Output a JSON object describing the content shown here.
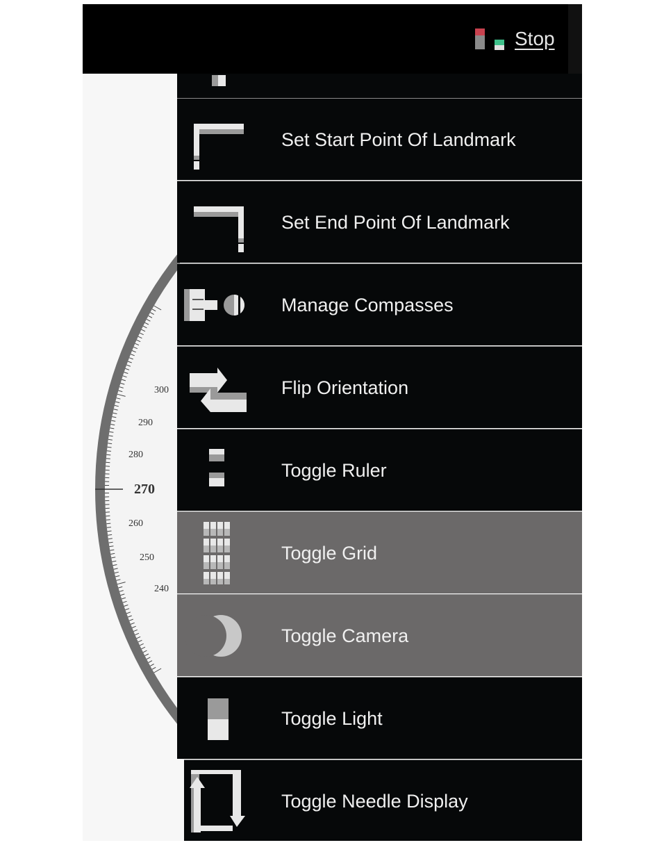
{
  "header": {
    "stop_label": "Stop",
    "indicator_colors": {
      "red": "#c8424f",
      "green": "#3ec08a",
      "gray": "#8a8a8a"
    }
  },
  "compass": {
    "tick_labels": [
      "300",
      "290",
      "280",
      "270",
      "260",
      "250",
      "240"
    ],
    "ring_color": "#6e6e6e"
  },
  "menu": {
    "highlight_color": "#6b6969",
    "items": [
      {
        "label": "Set Start Point Of Landmark",
        "icon": "start-point-corner-icon",
        "highlighted": false
      },
      {
        "label": "Set End Point Of Landmark",
        "icon": "end-point-corner-icon",
        "highlighted": false
      },
      {
        "label": "Manage Compasses",
        "icon": "compasses-icon",
        "highlighted": false
      },
      {
        "label": "Flip Orientation",
        "icon": "flip-arrows-icon",
        "highlighted": false
      },
      {
        "label": "Toggle Ruler",
        "icon": "ruler-icon",
        "highlighted": false
      },
      {
        "label": "Toggle Grid",
        "icon": "grid-icon",
        "highlighted": true
      },
      {
        "label": "Toggle Camera",
        "icon": "crescent-icon",
        "highlighted": true
      },
      {
        "label": "Toggle Light",
        "icon": "light-icon",
        "highlighted": false
      },
      {
        "label": "Toggle Needle Display",
        "icon": "needle-loop-icon",
        "highlighted": false
      }
    ]
  }
}
